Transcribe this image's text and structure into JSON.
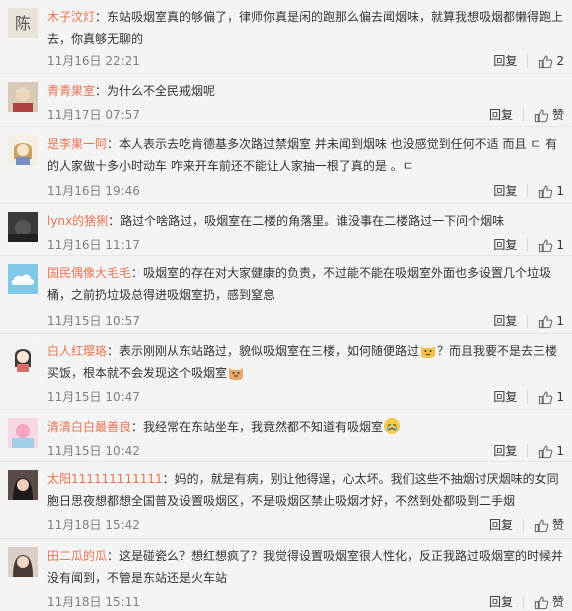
{
  "comments": [
    {
      "user": "木子汶灯",
      "avatar_kind": "text",
      "avatar_text": "陈",
      "text": "东站吸烟室真的够偏了，律师你真是闲的跑那么偏去闻烟味，就算我想吸烟都懒得跑上去，你真够无聊的",
      "time": "11月16日 22:21",
      "reply": "回复",
      "likes": "2"
    },
    {
      "user": "青青果室",
      "avatar_kind": "person",
      "text": "为什么不全民戒烟呢",
      "time": "11月17日 07:57",
      "reply": "回复",
      "likes": "赞"
    },
    {
      "user": "是李果一阿",
      "avatar_kind": "anime",
      "text": "本人表示去吃肯德基多次路过禁烟室  并未闻到烟味 也没感觉到任何不适 而且 ㄷ 有的人家做十多小时动车 咋来开车前还不能让人家抽一根了真的是 。ㄷ",
      "time": "11月16日 19:46",
      "reply": "回复",
      "likes": "1"
    },
    {
      "user": "lynx的猞猁",
      "avatar_kind": "dark",
      "text": "路过个啥路过，吸烟室在二楼的角落里。谁没事在二楼路过一下问个烟味",
      "time": "11月16日 11:17",
      "reply": "回复",
      "likes": "1"
    },
    {
      "user": "国民偶像大毛毛",
      "avatar_kind": "cloud",
      "text": "吸烟室的存在对大家健康的负责，不过能不能在吸烟室外面也多设置几个垃圾桶，之前扔垃圾总得进吸烟室扔，感到窒息",
      "time": "11月15日 10:57",
      "reply": "回复",
      "likes": "1"
    },
    {
      "user": "白人红璎珞",
      "avatar_kind": "girl",
      "text": "表示刚刚从东站路过，貌似吸烟室在三楼，如何随便路过",
      "text2": "？而且我要不是去三楼买饭，根本就不会发现这个吸烟室",
      "time": "11月15日 10:47",
      "reply": "回复",
      "likes": "1"
    },
    {
      "user": "清清白白最善良",
      "avatar_kind": "pink",
      "text": "我经常在东站坐车，我竟然都不知道有吸烟室",
      "time": "11月15日 10:42",
      "reply": "回复",
      "likes": "1"
    },
    {
      "user": "太阳111111111111",
      "avatar_kind": "woman",
      "text": "妈的，就是有病，别让他得逞，心太坏。我们这些不抽烟讨厌烟味的女同胞日思夜想都想全国普及设置吸烟区，不是吸烟区禁止吸烟才好，不然到处都吸到二手烟",
      "time": "11月18日 15:42",
      "reply": "回复",
      "likes": "赞"
    },
    {
      "user": "田二瓜的瓜",
      "avatar_kind": "woman2",
      "text": "这是碰瓷么？想红想疯了？我觉得设置吸烟室很人性化，反正我路过吸烟室的时候并没有闻到，不管是东站还是火车站",
      "time": "11月18日 15:11",
      "reply": "回复",
      "likes": "赞"
    }
  ],
  "colors": {
    "username": "#eb7350",
    "time": "#808080",
    "text": "#333333"
  },
  "icons": {
    "like": "thumbs-up-icon"
  }
}
